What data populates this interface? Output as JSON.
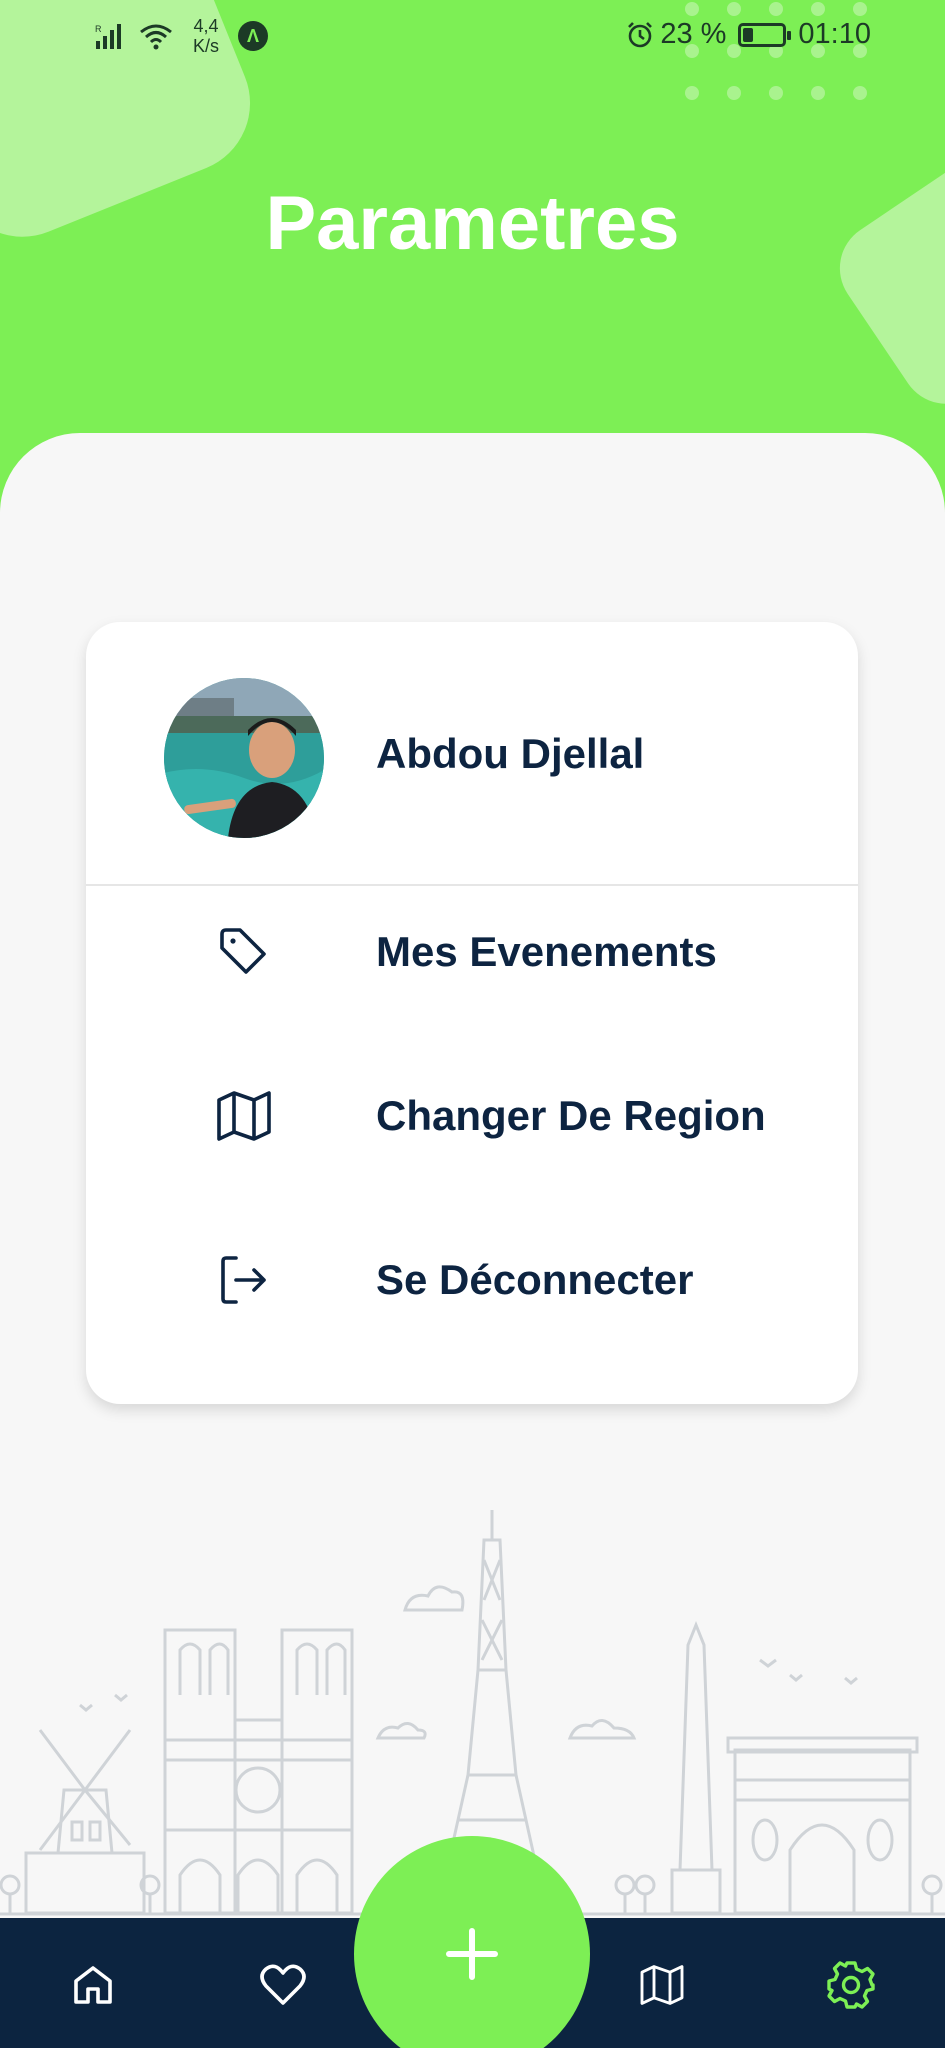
{
  "status_bar": {
    "network_speed_value": "4,4",
    "network_speed_unit": "K/s",
    "battery_percent": "23 %",
    "battery_level": 0.23,
    "time": "01:10",
    "icons": [
      "signal-icon",
      "wifi-icon",
      "app-notification-icon",
      "alarm-icon",
      "battery-icon"
    ]
  },
  "header": {
    "title": "Parametres",
    "color": "#7def55"
  },
  "profile": {
    "name": "Abdou Djellal"
  },
  "menu": {
    "items": [
      {
        "label": "Mes Evenements",
        "icon": "tag-icon"
      },
      {
        "label": "Changer De Region",
        "icon": "map-icon"
      },
      {
        "label": "Se Déconnecter",
        "icon": "logout-icon"
      }
    ]
  },
  "bottom_nav": {
    "items": [
      {
        "icon": "home-icon"
      },
      {
        "icon": "heart-icon"
      },
      {
        "icon": "plus-icon"
      },
      {
        "icon": "map-icon"
      },
      {
        "icon": "settings-gear-icon",
        "active": true
      }
    ],
    "background": "#0c2440",
    "active_color": "#7def55",
    "icon_color": "#ffffff"
  },
  "colors": {
    "text_primary": "#0d2441",
    "accent": "#7def55"
  }
}
